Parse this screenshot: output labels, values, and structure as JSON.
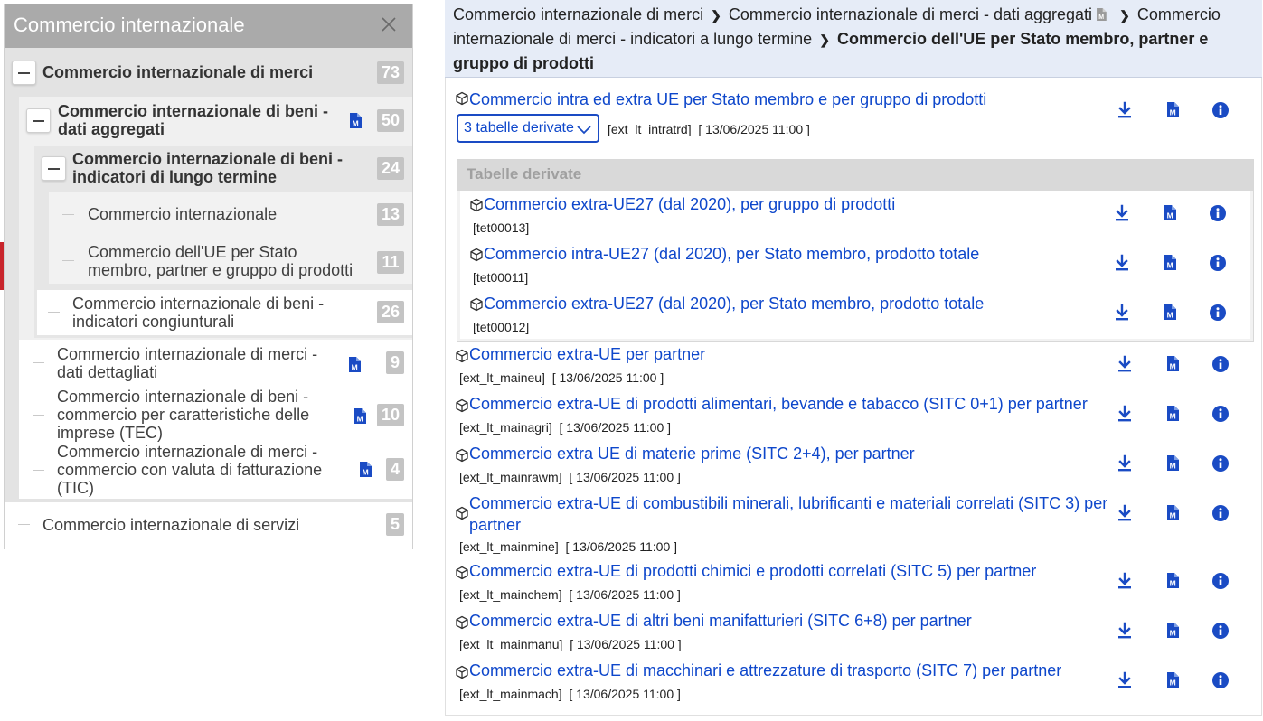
{
  "tree": {
    "title": "Commercio internazionale",
    "items": [
      {
        "label": "Commercio internazionale di merci",
        "count": "73"
      },
      {
        "label": "Commercio internazionale di beni - dati aggregati",
        "count": "50"
      },
      {
        "label": "Commercio internazionale di beni - indicatori di lungo termine",
        "count": "24"
      },
      {
        "label": "Commercio internazionale",
        "count": "13"
      },
      {
        "label": "Commercio dell'UE per Stato membro, partner e gruppo di prodotti",
        "count": "11"
      },
      {
        "label": "Commercio internazionale di beni - indicatori congiunturali",
        "count": "26"
      },
      {
        "label": "Commercio internazionale di merci - dati dettagliati",
        "count": "9"
      },
      {
        "label": "Commercio internazionale di beni - commercio per caratteristiche delle imprese (TEC)",
        "count": "10"
      },
      {
        "label": "Commercio internazionale di merci - commercio con valuta di fatturazione (TIC)",
        "count": "4"
      },
      {
        "label": "Commercio internazionale di servizi",
        "count": "5"
      }
    ]
  },
  "breadcrumb": {
    "crumb1": "Commercio internazionale di merci",
    "crumb2": "Commercio internazionale di merci - dati aggregati",
    "crumb3": "Commercio internazionale di merci - indicatori a lungo termine",
    "current": "Commercio dell'UE per Stato membro, partner e gruppo di prodotti",
    "separator": "❯"
  },
  "main_dataset": {
    "title": "Commercio intra ed extra UE per Stato membro e per gruppo di prodotti",
    "derived_select": "3 tabelle derivate",
    "code": "[ext_lt_intratrd]",
    "updated": "[ 13/06/2025 11:00 ]"
  },
  "derived": {
    "header": "Tabelle derivate",
    "items": [
      {
        "title": "Commercio extra-UE27 (dal 2020), per gruppo di prodotti",
        "code": "[tet00013]"
      },
      {
        "title": "Commercio intra-UE27 (dal 2020), per Stato membro, prodotto totale",
        "code": "[tet00011]"
      },
      {
        "title": "Commercio extra-UE27 (dal 2020), per Stato membro, prodotto totale",
        "code": "[tet00012]"
      }
    ]
  },
  "datasets": [
    {
      "title": "Commercio extra-UE per partner",
      "code": "[ext_lt_maineu]",
      "updated": "[ 13/06/2025 11:00 ]"
    },
    {
      "title": "Commercio extra-UE di prodotti alimentari, bevande e tabacco (SITC 0+1) per partner",
      "code": "[ext_lt_mainagri]",
      "updated": "[ 13/06/2025 11:00 ]"
    },
    {
      "title": "Commercio extra UE di materie prime (SITC 2+4), per partner",
      "code": "[ext_lt_mainrawm]",
      "updated": "[ 13/06/2025 11:00 ]"
    },
    {
      "title": "Commercio extra-UE di combustibili minerali, lubrificanti e materiali correlati (SITC 3) per",
      "title2": "partner",
      "code": "[ext_lt_mainmine]",
      "updated": "[ 13/06/2025 11:00 ]"
    },
    {
      "title": "Commercio extra-UE di prodotti chimici e prodotti correlati (SITC 5) per partner",
      "code": "[ext_lt_mainchem]",
      "updated": "[ 13/06/2025 11:00 ]"
    },
    {
      "title": "Commercio extra-UE di altri beni manifatturieri (SITC 6+8) per partner",
      "code": "[ext_lt_mainmanu]",
      "updated": "[ 13/06/2025 11:00 ]"
    },
    {
      "title": "Commercio extra-UE di macchinari e attrezzature di trasporto (SITC 7) per partner",
      "code": "[ext_lt_mainmach]",
      "updated": "[ 13/06/2025 11:00 ]"
    }
  ],
  "colors": {
    "link": "#0e47cb",
    "tree_header": "#aaaaaa",
    "breadcrumb_bg": "#e6ecf7",
    "count_badge": "#c4c4c4",
    "accent_red": "#c8242b"
  }
}
